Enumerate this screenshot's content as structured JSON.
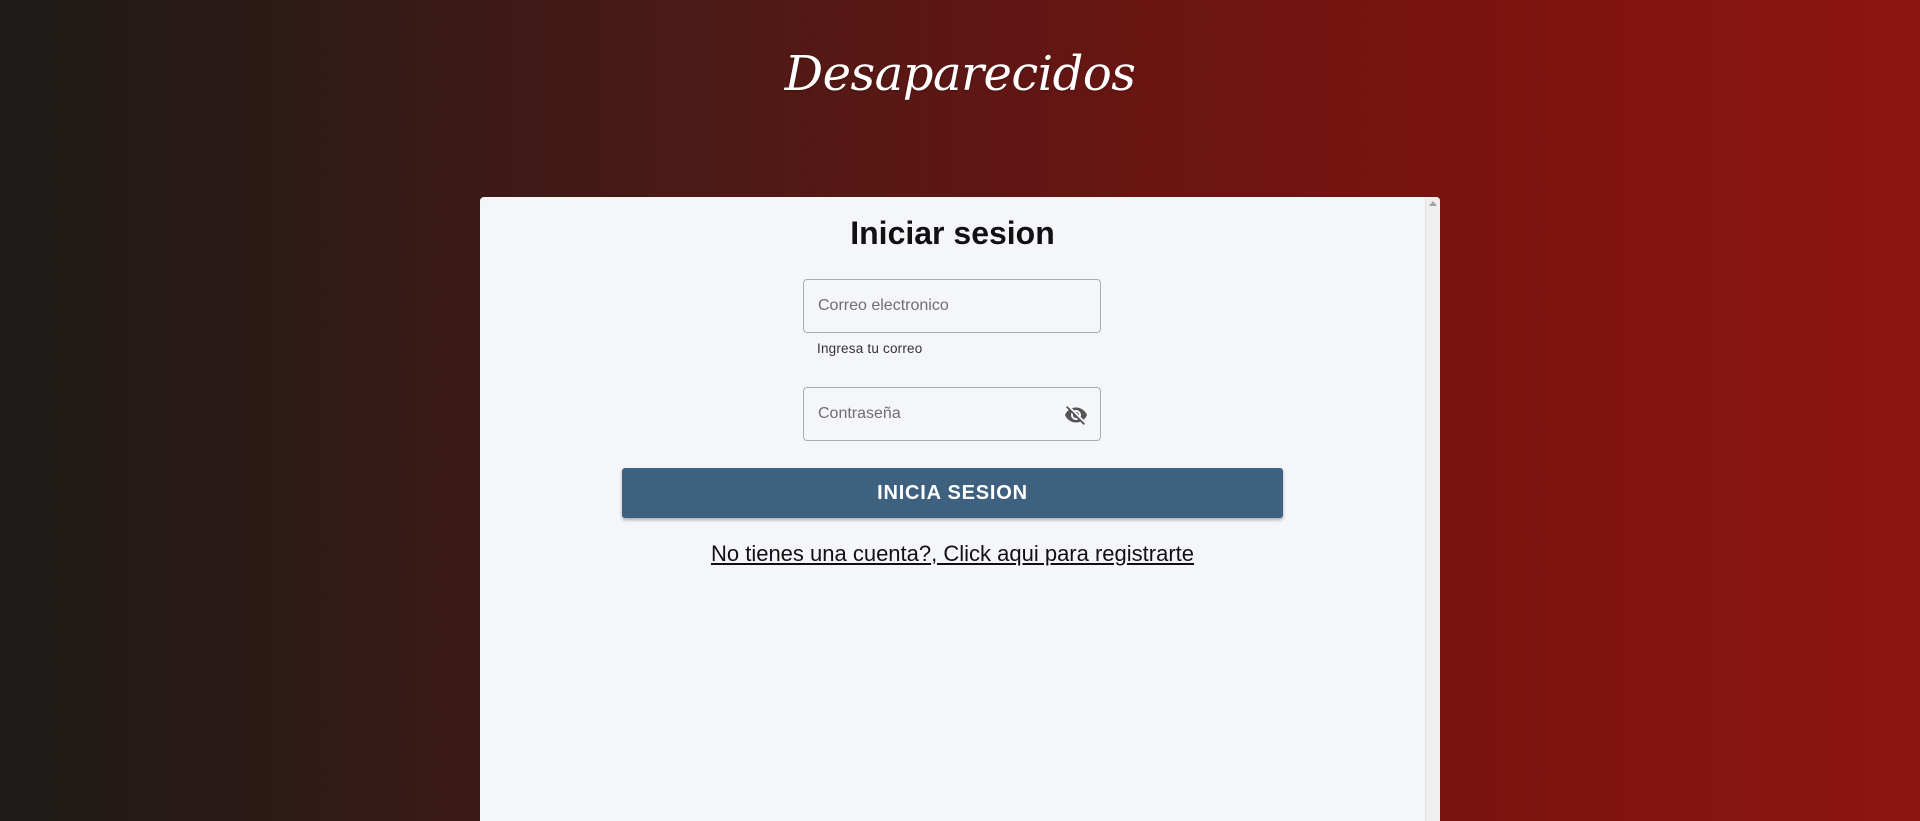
{
  "app": {
    "brand": "Desaparecidos"
  },
  "login": {
    "title": "Iniciar sesion",
    "email": {
      "placeholder": "Correo electronico",
      "value": "",
      "helper": "Ingresa tu correo"
    },
    "password": {
      "placeholder": "Contraseña",
      "value": "",
      "toggle_icon": "eye-off-icon"
    },
    "submit_label": "INICIA SESION",
    "register_link": "No tienes una cuenta?, Click aqui para registrarte"
  },
  "colors": {
    "button": "#3f6180",
    "card_background": "#f5f6fa",
    "background_left": "#1e1c19",
    "background_right": "#8e1511"
  }
}
